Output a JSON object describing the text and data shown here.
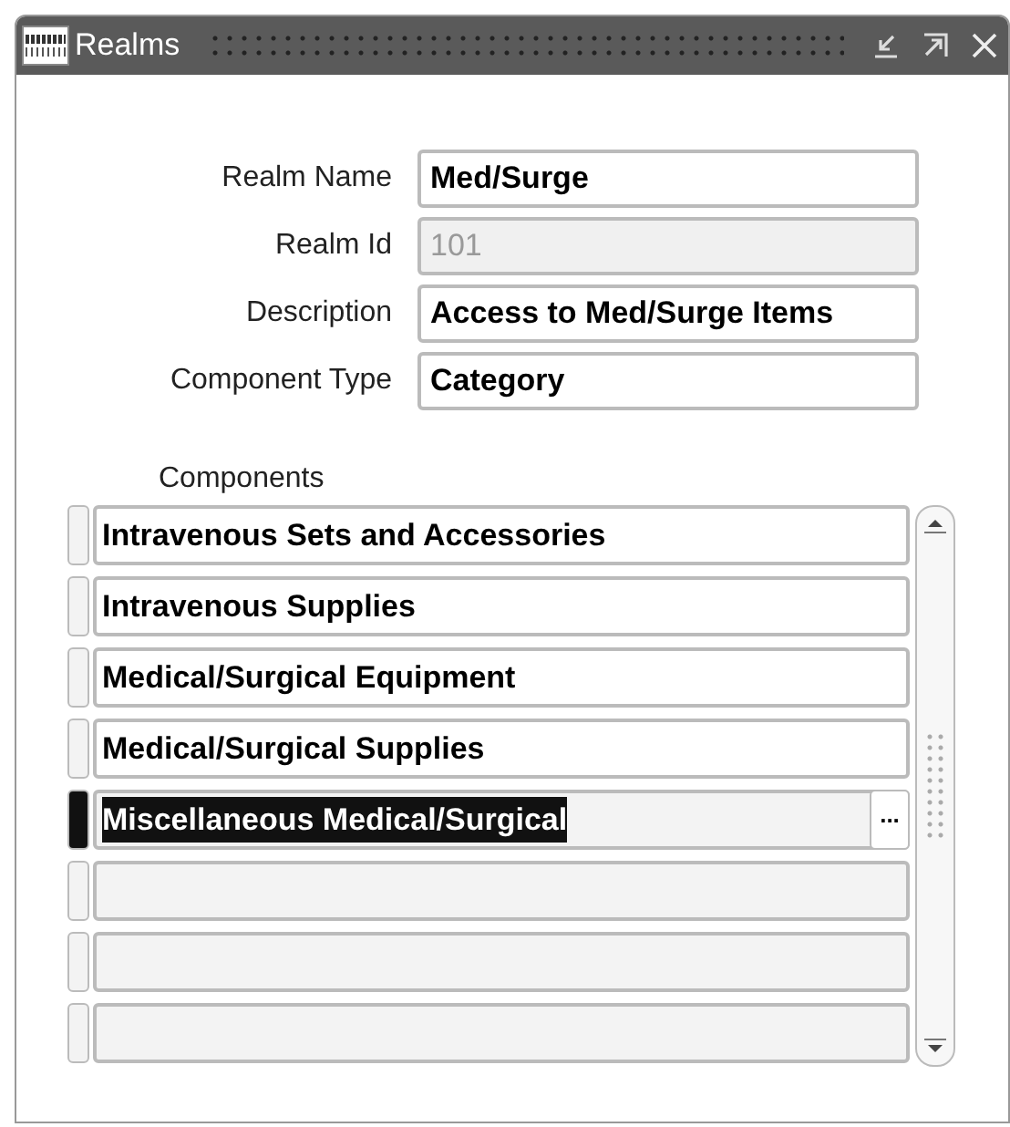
{
  "window": {
    "title": "Realms"
  },
  "fields": [
    {
      "label": "Realm Name",
      "value": "Med/Surge",
      "disabled": false
    },
    {
      "label": "Realm Id",
      "value": "101",
      "disabled": true
    },
    {
      "label": "Description",
      "value": "Access to Med/Surge Items",
      "disabled": false
    },
    {
      "label": "Component Type",
      "value": "Category",
      "disabled": false
    }
  ],
  "components": {
    "label": "Components",
    "rows": [
      {
        "value": "Intravenous Sets and Accessories",
        "selected": false
      },
      {
        "value": "Intravenous Supplies",
        "selected": false
      },
      {
        "value": "Medical/Surgical Equipment",
        "selected": false
      },
      {
        "value": "Medical/Surgical Supplies",
        "selected": false
      },
      {
        "value": "Miscellaneous Medical/Surgical",
        "selected": true,
        "button": "..."
      },
      {
        "selected": false
      },
      {
        "selected": false
      },
      {
        "selected": false
      }
    ]
  }
}
